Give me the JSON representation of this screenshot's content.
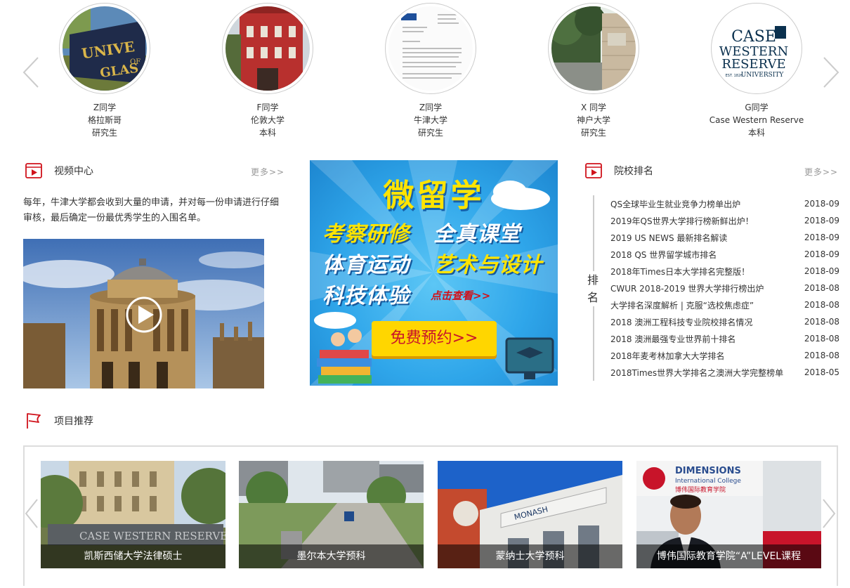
{
  "students": [
    {
      "name": "Z同学",
      "school": "格拉斯哥",
      "level": "研究生",
      "image": "university-sign-photo"
    },
    {
      "name": "F同学",
      "school": "伦敦大学",
      "level": "本科",
      "image": "red-brick-building-photo"
    },
    {
      "name": "Z同学",
      "school": "牛津大学",
      "level": "研究生",
      "image": "offer-letter-photo"
    },
    {
      "name": "X 同学",
      "school": "神户大学",
      "level": "研究生",
      "image": "campus-gate-photo"
    },
    {
      "name": "G同学",
      "school": "Case Western Reserve",
      "level": "本科",
      "image": "case-western-logo"
    }
  ],
  "logo": {
    "case_line1": "CASE",
    "case_line2": "WESTERN",
    "case_line3": "RESERVE",
    "case_line4": "UNIVERSITY",
    "case_est": "EST. 1826"
  },
  "video": {
    "title": "视频中心",
    "more": "更多>>",
    "description": "每年，牛津大学都会收到大量的申请，并对每一份申请进行仔细审核，最后确定一份最优秀学生的入围名单。"
  },
  "banner": {
    "title": "微留学",
    "line1a": "考察研修",
    "line1b": "全真课堂",
    "line2a": "体育运动",
    "line2b": "艺术与设计",
    "line3": "科技体验",
    "click": "点击查看>>",
    "button": "免费预约>>"
  },
  "ranking": {
    "title": "院校排名",
    "more": "更多>>",
    "side_label": "排名",
    "items": [
      {
        "title": "QS全球毕业生就业竞争力榜单出炉",
        "date": "2018-09"
      },
      {
        "title": "2019年QS世界大学排行榜新鲜出炉！",
        "date": "2018-09"
      },
      {
        "title": "2019 US NEWS 最新排名解读",
        "date": "2018-09"
      },
      {
        "title": "2018 QS 世界留学城市排名",
        "date": "2018-09"
      },
      {
        "title": "2018年Times日本大学排名完整版！",
        "date": "2018-09"
      },
      {
        "title": "CWUR 2018-2019 世界大学排行榜出炉",
        "date": "2018-08"
      },
      {
        "title": "大学排名深度解析 | 克服“选校焦虑症”",
        "date": "2018-08"
      },
      {
        "title": "2018 澳洲工程科技专业院校排名情况",
        "date": "2018-08"
      },
      {
        "title": "2018 澳洲最强专业世界前十排名",
        "date": "2018-08"
      },
      {
        "title": "2018年麦考林加拿大大学排名",
        "date": "2018-08"
      },
      {
        "title": "2018Times世界大学排名之澳洲大学完整榜单",
        "date": "2018-05"
      }
    ]
  },
  "projects": {
    "title": "项目推荐",
    "items": [
      {
        "caption": "凯斯西储大学法律硕士",
        "sign": "CASE WESTERN RESERVE"
      },
      {
        "caption": "墨尔本大学预科",
        "sign": ""
      },
      {
        "caption": "蒙纳士大学预科",
        "sign": "MONASH"
      },
      {
        "caption": "博伟国际教育学院“A”LEVEL课程",
        "sign": "DIMENSIONS",
        "sign2": "International College",
        "sign3": "博伟国际教育学院"
      }
    ]
  },
  "colors": {
    "accent_red": "#d0121b",
    "border": "#dddddd",
    "banner_blue": "#2fa6ea",
    "banner_yellow": "#ffe400"
  }
}
